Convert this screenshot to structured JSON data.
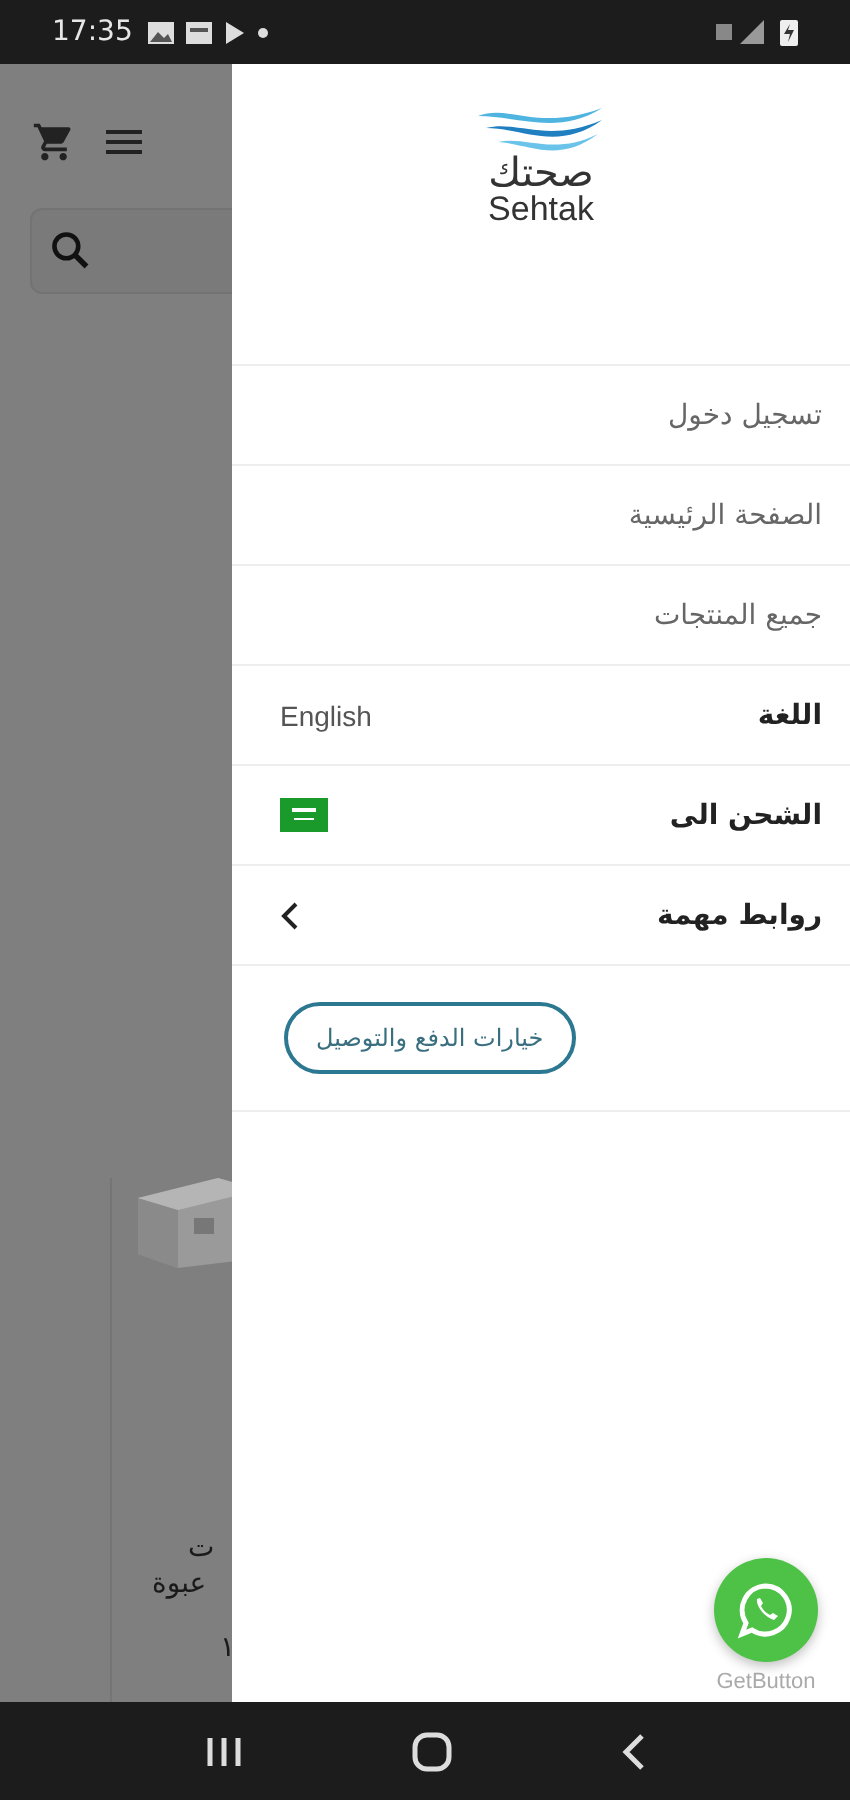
{
  "status_bar": {
    "time": "17:35"
  },
  "background": {
    "product_lines": [
      "ت",
      "عبوة",
      "١"
    ]
  },
  "drawer": {
    "logo": {
      "arabic": "صحتك",
      "latin": "Sehtak"
    },
    "items": [
      {
        "kind": "link",
        "label": "تسجيل دخول"
      },
      {
        "kind": "link",
        "label": "الصفحة الرئيسية"
      },
      {
        "kind": "link",
        "label": "جميع المنتجات"
      },
      {
        "kind": "value",
        "label": "اللغة",
        "value": "English"
      },
      {
        "kind": "flag",
        "label": "الشحن الى"
      },
      {
        "kind": "submenu",
        "label": "روابط مهمة"
      }
    ],
    "button": "خيارات الدفع والتوصيل"
  },
  "chat_button": {
    "caption": "GetButton"
  }
}
